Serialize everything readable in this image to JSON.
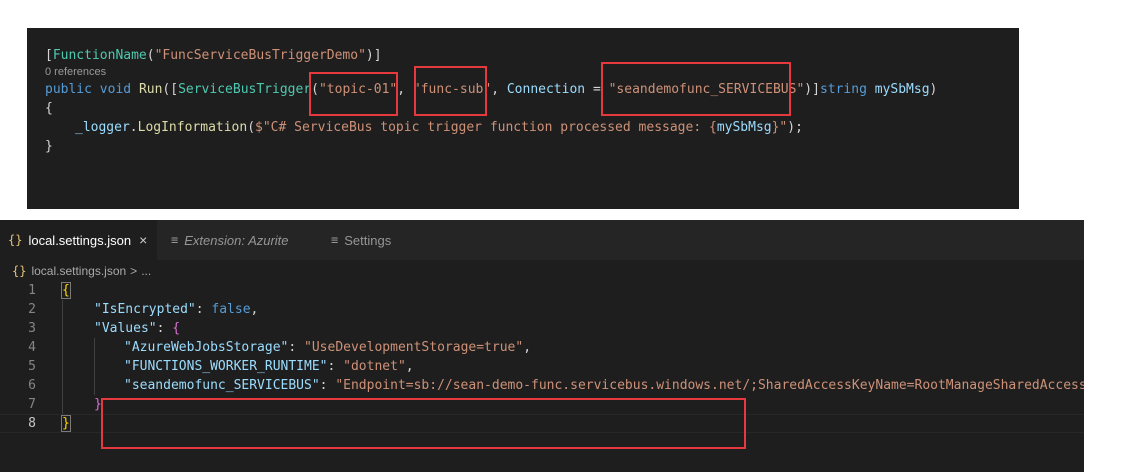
{
  "code_snippet": {
    "attribute_line": {
      "open": "[",
      "name": "FunctionName",
      "paren_open": "(",
      "value": "\"FuncServiceBusTriggerDemo\"",
      "close": ")]"
    },
    "references": "0 references",
    "signature": {
      "public": "public",
      "void": "void",
      "run": "Run",
      "p1": "([",
      "trigger": "ServiceBusTrigger",
      "p2": "(",
      "topic": "\"topic-01\"",
      "comma1": ", ",
      "sub": "\"func-sub\"",
      "comma2": ", ",
      "conn_label": "Connection",
      "eq": " = ",
      "conn_value": "\"seandemofunc_SERVICEBUS\"",
      "p3": ")]",
      "string": "string",
      "param": "mySbMsg",
      "p4": ")"
    },
    "brace_open": "{",
    "log_line": {
      "logger": "_logger",
      "dot": ".",
      "method": "LogInformation",
      "p1": "(",
      "str1": "$\"C# ServiceBus topic trigger function processed message: {",
      "var": "mySbMsg",
      "str2": "}\"",
      "end": ");"
    },
    "brace_close": "}"
  },
  "editor": {
    "tabs": [
      {
        "icon": "{}",
        "label": "local.settings.json",
        "close": "×",
        "active": true
      },
      {
        "icon": "≡",
        "label": "Extension: Azurite",
        "active": false
      },
      {
        "icon": "≡",
        "label": "Settings",
        "active": false
      }
    ],
    "breadcrumb": {
      "icon": "{}",
      "file": "local.settings.json",
      "sep": ">",
      "more": "..."
    },
    "line_numbers": [
      "1",
      "2",
      "3",
      "4",
      "5",
      "6",
      "7",
      "8"
    ],
    "json": {
      "open": "{",
      "is_encrypted_key": "\"IsEncrypted\"",
      "is_encrypted_val": "false",
      "values_key": "\"Values\"",
      "values_open": "{",
      "storage_key": "\"AzureWebJobsStorage\"",
      "storage_val": "\"UseDevelopmentStorage=true\"",
      "runtime_key": "\"FUNCTIONS_WORKER_RUNTIME\"",
      "runtime_val": "\"dotnet\"",
      "sb_key": "\"seandemofunc_SERVICEBUS\"",
      "sb_val": "\"Endpoint=sb://sean-demo-func.servicebus.windows.net/;SharedAccessKeyName=RootManageSharedAccessKe",
      "values_close": "}",
      "close": "}",
      "colon": ": ",
      "comma": ","
    }
  },
  "colors": {
    "highlight": "#e5393e",
    "editor_bg": "#1e1e1e",
    "tab_bar_bg": "#252526"
  }
}
